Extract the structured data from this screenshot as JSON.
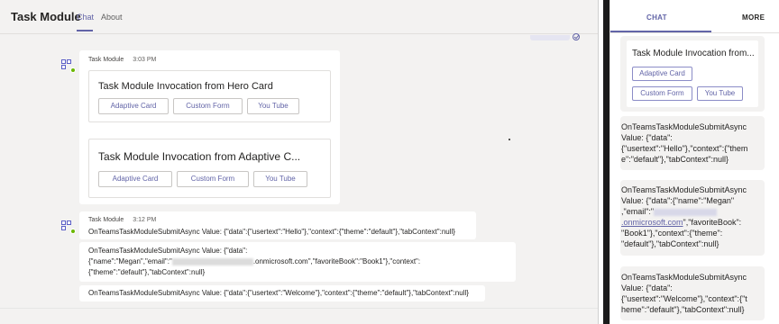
{
  "header": {
    "app_title": "Task Module",
    "tabs": [
      {
        "label": "Chat",
        "active": true
      },
      {
        "label": "About",
        "active": false
      }
    ]
  },
  "messages": [
    {
      "sender": "Task Module",
      "time": "3:03 PM",
      "cards": [
        {
          "title": "Task Module Invocation from Hero Card",
          "buttons": [
            "Adaptive Card",
            "Custom Form",
            "You Tube"
          ]
        },
        {
          "title": "Task Module Invocation from Adaptive C...",
          "buttons": [
            "Adaptive Card",
            "Custom Form",
            "You Tube"
          ]
        }
      ]
    },
    {
      "sender": "Task Module",
      "time": "3:12 PM",
      "lines": [
        {
          "text": "OnTeamsTaskModuleSubmitAsync Value: {\"data\":{\"usertext\":\"Hello\"},\"context\":{\"theme\":\"default\"},\"tabContext\":null}"
        },
        {
          "line1": "OnTeamsTaskModuleSubmitAsync Value: {\"data\":",
          "line2_a": "{\"name\":\"Megan\",\"email\":\"",
          "line2_b": ".onmicrosoft.com\",\"favoriteBook\":\"Book1\"},\"context\":",
          "line3": "{\"theme\":\"default\"},\"tabContext\":null}"
        },
        {
          "text": "OnTeamsTaskModuleSubmitAsync Value: {\"data\":{\"usertext\":\"Welcome\"},\"context\":{\"theme\":\"default\"},\"tabContext\":null}"
        }
      ]
    }
  ],
  "mobile": {
    "tabs": [
      {
        "label": "CHAT",
        "active": true
      },
      {
        "label": "MORE",
        "active": false
      }
    ],
    "card": {
      "title": "Task Module Invocation from...",
      "buttons": [
        "Adaptive Card",
        "Custom Form",
        "You Tube"
      ]
    },
    "messages": [
      {
        "lines": [
          "OnTeamsTaskModuleSubmitAsync",
          "Value: {\"data\":",
          "{\"usertext\":\"Hello\"},\"context\":{\"them",
          "e\":\"default\"},\"tabContext\":null}"
        ]
      },
      {
        "lines": [
          "OnTeamsTaskModuleSubmitAsync",
          "Value: {\"data\":{\"name\":\"Megan\"",
          ",\"email\":\""
        ],
        "link": ".onmicrosoft.com",
        "after_link": "\",\"favoriteBook\":",
        "tail": [
          "\"Book1\"},\"context\":{\"theme\":",
          "\"default\"},\"tabContext\":null}"
        ]
      },
      {
        "lines": [
          "OnTeamsTaskModuleSubmitAsync",
          "Value: {\"data\":",
          "{\"usertext\":\"Welcome\"},\"context\":{\"t",
          "heme\":\"default\"},\"tabContext\":null}"
        ]
      }
    ]
  },
  "colors": {
    "accent": "#6264a7",
    "presence": "#6bb700",
    "pane_bg": "#f3f2f1"
  }
}
